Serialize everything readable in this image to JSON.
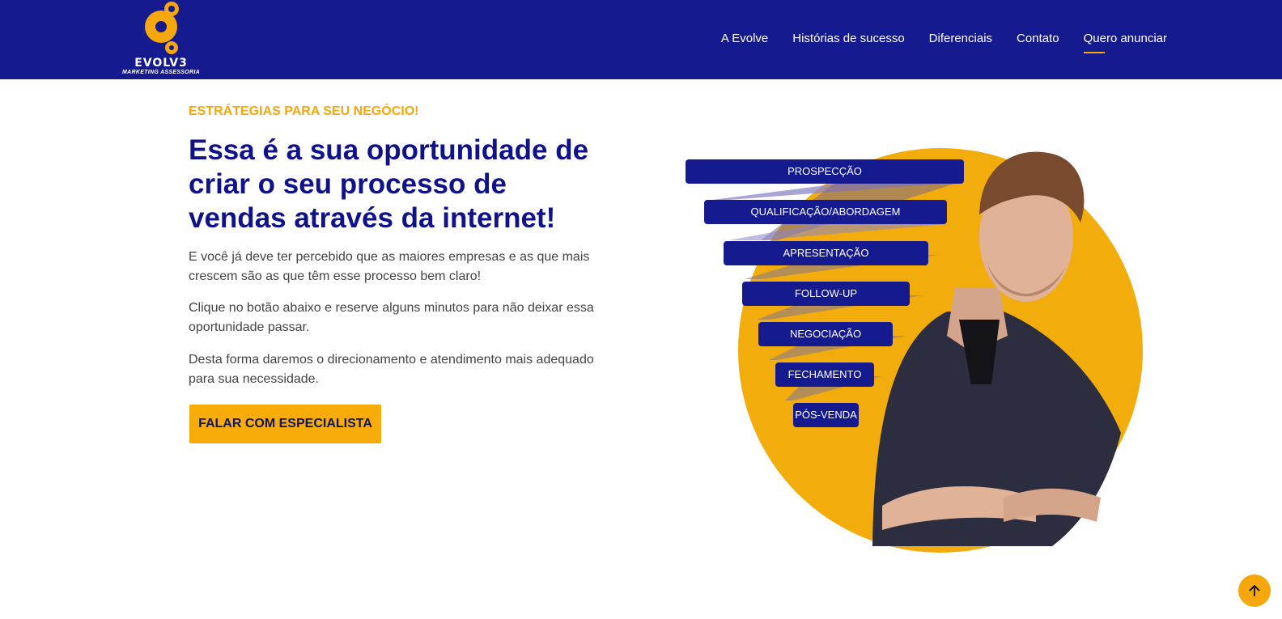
{
  "brand": {
    "name": "EVOLV3",
    "tagline": "MARKETING ASSESSORIA"
  },
  "nav": {
    "items": [
      {
        "label": "A Evolve",
        "active": false
      },
      {
        "label": "Histórias de sucesso",
        "active": false
      },
      {
        "label": "Diferenciais",
        "active": false
      },
      {
        "label": "Contato",
        "active": false
      },
      {
        "label": "Quero anunciar",
        "active": true
      }
    ]
  },
  "hero": {
    "eyebrow": "ESTRÁTEGIAS PARA SEU NEGÓCIO!",
    "headline": "Essa é a sua oportunidade de criar o seu processo de vendas através da internet!",
    "paragraphs": [
      "E você já deve ter percebido que as maiores empresas e as que mais crescem são as que têm esse processo bem claro!",
      "Clique no botão abaixo e reserve alguns minutos para não deixar essa oportunidade passar.",
      "Desta forma daremos o direcionamento e atendimento mais adequado para sua necessidade."
    ],
    "cta_label": "FALAR COM ESPECIALISTA"
  },
  "funnel": {
    "steps": [
      "PROSPECÇÃO",
      "QUALIFICAÇÃO/ABORDAGEM",
      "APRESENTAÇÃO",
      "FOLLOW-UP",
      "NEGOCIAÇÃO",
      "FECHAMENTO",
      "PÓS-VENDA"
    ]
  },
  "colors": {
    "navy": "#161a8f",
    "heading": "#10128a",
    "accent": "#f5a70d",
    "body_text": "#444444"
  },
  "icons": {
    "logo": "evolve-logo",
    "back_to_top": "arrow-up-icon"
  }
}
